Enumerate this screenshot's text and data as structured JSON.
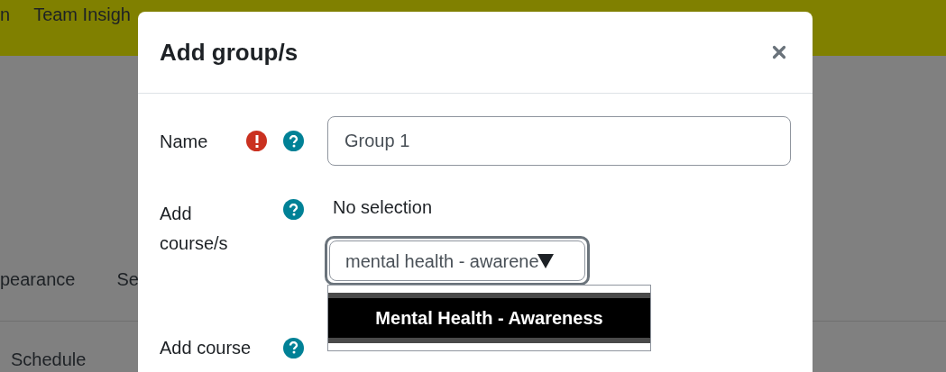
{
  "background": {
    "nav_items": [
      "n",
      "Team Insigh"
    ],
    "tabs": [
      "pearance",
      "Se"
    ],
    "menu_item": "Schedule"
  },
  "dialog": {
    "title": "Add group/s",
    "name_field": {
      "label": "Name",
      "required": true,
      "value": "Group 1"
    },
    "course_field": {
      "label": "Add course/s",
      "selection_text": "No selection",
      "search_value": "mental health - awarene",
      "options": [
        {
          "label": "Mental Health - Awareness",
          "selected": true
        }
      ]
    },
    "section_field": {
      "label": "Add course"
    }
  }
}
